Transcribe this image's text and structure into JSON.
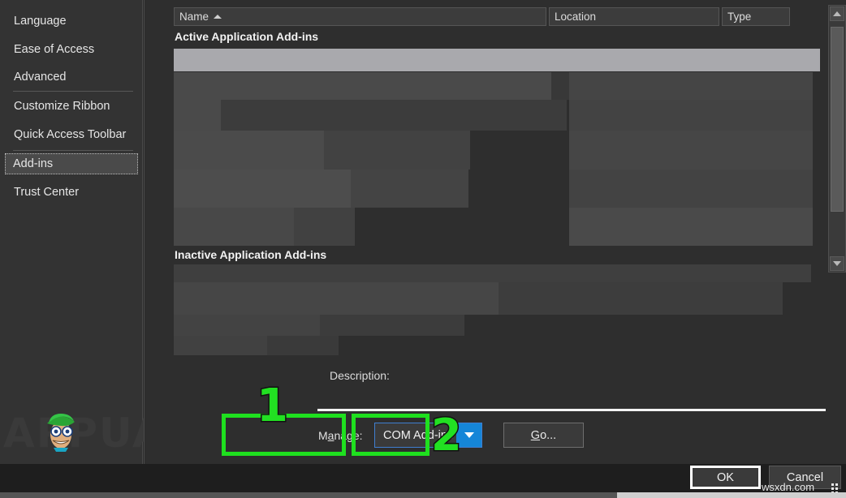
{
  "sidebar": {
    "items": [
      {
        "label": "Language",
        "selected": false
      },
      {
        "label": "Ease of Access",
        "selected": false
      },
      {
        "label": "Advanced",
        "selected": false
      },
      {
        "label": "Customize Ribbon",
        "selected": false
      },
      {
        "label": "Quick Access Toolbar",
        "selected": false
      },
      {
        "label": "Add-ins",
        "selected": true
      },
      {
        "label": "Trust Center",
        "selected": false
      }
    ]
  },
  "list": {
    "columns": [
      {
        "label": "Name",
        "sorted": "ascending"
      },
      {
        "label": "Location",
        "sorted": ""
      },
      {
        "label": "Type",
        "sorted": ""
      }
    ],
    "groups": [
      {
        "label": "Active Application Add-ins"
      },
      {
        "label": "Inactive Application Add-ins"
      }
    ]
  },
  "description": {
    "label": "Description:",
    "value": ""
  },
  "manage": {
    "label": "Manage:",
    "label_accel": "a",
    "selected_option": "COM Add-ins",
    "options": [
      "COM Add-ins"
    ],
    "go_label": "Go...",
    "go_accel": "G"
  },
  "dialog_buttons": {
    "ok": "OK",
    "cancel": "Cancel"
  },
  "annotations": [
    {
      "number": "1",
      "target": "manage-dropdown"
    },
    {
      "number": "2",
      "target": "go-button"
    }
  ],
  "colors": {
    "annotation_green": "#22e022",
    "combo_border_blue": "#3f7fd0",
    "combo_drop_blue": "#1586d8",
    "selected_row": "#a9a9ad",
    "panel_bg": "#2e2e2e",
    "sidebar_bg": "#333333"
  },
  "watermarks": {
    "brand": "APPUALS",
    "site": "wsxdn.com"
  }
}
